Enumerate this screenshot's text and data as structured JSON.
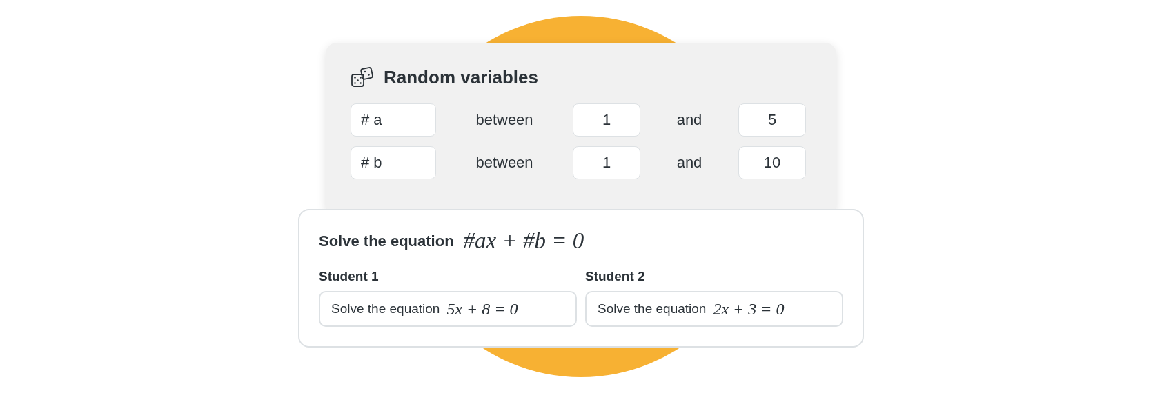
{
  "variables_card": {
    "title": "Random variables",
    "rows": [
      {
        "variable": "# a",
        "between_label": "between",
        "min": "1",
        "and_label": "and",
        "max": "5"
      },
      {
        "variable": "# b",
        "between_label": "between",
        "min": "1",
        "and_label": "and",
        "max": "10"
      }
    ]
  },
  "question_card": {
    "prompt": "Solve the equation",
    "formula": "#ax + #b = 0",
    "students": [
      {
        "name": "Student 1",
        "prompt": "Solve the equation",
        "formula": "5x + 8 = 0"
      },
      {
        "name": "Student 2",
        "prompt": "Solve the equation",
        "formula": "2x + 3 = 0"
      }
    ]
  }
}
